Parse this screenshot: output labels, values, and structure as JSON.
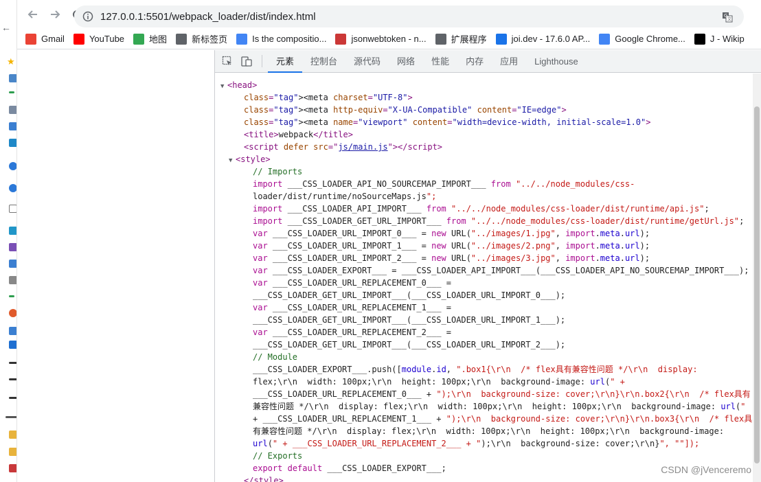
{
  "browser": {
    "url": "127.0.0.1:5501/webpack_loader/dist/index.html"
  },
  "bookmarks": [
    {
      "label": "Gmail",
      "icon": "gmail-icon",
      "color": "#ea4335"
    },
    {
      "label": "YouTube",
      "icon": "youtube-icon",
      "color": "#ff0000"
    },
    {
      "label": "地图",
      "icon": "maps-icon",
      "color": "#34a853"
    },
    {
      "label": "新标签页",
      "icon": "globe-icon",
      "color": "#5f6368"
    },
    {
      "label": "Is the compositio...",
      "icon": "google-icon",
      "color": "#4285f4"
    },
    {
      "label": "jsonwebtoken - n...",
      "icon": "npm-icon",
      "color": "#cb3837"
    },
    {
      "label": "扩展程序",
      "icon": "puzzle-icon",
      "color": "#5f6368"
    },
    {
      "label": "joi.dev - 17.6.0 AP...",
      "icon": "joi-icon",
      "color": "#1a73e8"
    },
    {
      "label": "Google Chrome...",
      "icon": "chrome-icon",
      "color": "#4285f4"
    },
    {
      "label": "J - Wikip",
      "icon": "wikipedia-icon",
      "color": "#000000"
    }
  ],
  "devtools": {
    "tabs": [
      "元素",
      "控制台",
      "源代码",
      "网络",
      "性能",
      "内存",
      "应用",
      "Lighthouse"
    ],
    "active_tab": "元素",
    "accent": "#1a73e8"
  },
  "code": {
    "head_open": "<head>",
    "meta_charset": "<meta charset=\"UTF-8\">",
    "meta_compat": "<meta http-equiv=\"X-UA-Compatible\" content=\"IE=edge\">",
    "meta_viewport": "<meta name=\"viewport\" content=\"width=device-width, initial-scale=1.0\">",
    "title": "webpack",
    "script_src": "js/main.js",
    "style_open": "<style>",
    "style_close": "</style>",
    "lines": [
      "// Imports",
      "import ___CSS_LOADER_API_NO_SOURCEMAP_IMPORT___ from \"../../node_modules/css-",
      "loader/dist/runtime/noSourceMaps.js\";",
      "import ___CSS_LOADER_API_IMPORT___ from \"../../node_modules/css-loader/dist/runtime/api.js\";",
      "import ___CSS_LOADER_GET_URL_IMPORT___ from \"../../node_modules/css-loader/dist/runtime/getUrl.js\";",
      "var ___CSS_LOADER_URL_IMPORT_0___ = new URL(\"../images/1.jpg\", import.meta.url);",
      "var ___CSS_LOADER_URL_IMPORT_1___ = new URL(\"../images/2.png\", import.meta.url);",
      "var ___CSS_LOADER_URL_IMPORT_2___ = new URL(\"../images/3.jpg\", import.meta.url);",
      "var ___CSS_LOADER_EXPORT___ = ___CSS_LOADER_API_IMPORT___(___CSS_LOADER_API_NO_SOURCEMAP_IMPORT___);",
      "var ___CSS_LOADER_URL_REPLACEMENT_0___ =",
      "___CSS_LOADER_GET_URL_IMPORT___(___CSS_LOADER_URL_IMPORT_0___);",
      "var ___CSS_LOADER_URL_REPLACEMENT_1___ =",
      "___CSS_LOADER_GET_URL_IMPORT___(___CSS_LOADER_URL_IMPORT_1___);",
      "var ___CSS_LOADER_URL_REPLACEMENT_2___ =",
      "___CSS_LOADER_GET_URL_IMPORT___(___CSS_LOADER_URL_IMPORT_2___);",
      "// Module",
      "___CSS_LOADER_EXPORT___.push([module.id, \".box1{\\r\\n  /* flex具有兼容性问题 */\\r\\n  display:",
      "flex;\\r\\n  width: 100px;\\r\\n  height: 100px;\\r\\n  background-image: url(\" +",
      "___CSS_LOADER_URL_REPLACEMENT_0___ + \");\\r\\n  background-size: cover;\\r\\n}\\r\\n.box2{\\r\\n  /* flex具有",
      "兼容性问题 */\\r\\n  display: flex;\\r\\n  width: 100px;\\r\\n  height: 100px;\\r\\n  background-image: url(\"",
      "+ ___CSS_LOADER_URL_REPLACEMENT_1___ + \");\\r\\n  background-size: cover;\\r\\n}\\r\\n.box3{\\r\\n  /* flex具",
      "有兼容性问题 */\\r\\n  display: flex;\\r\\n  width: 100px;\\r\\n  height: 100px;\\r\\n  background-image:",
      "url(\" + ___CSS_LOADER_URL_REPLACEMENT_2___ + \");\\r\\n  background-size: cover;\\r\\n}\", \"\"]);",
      "// Exports",
      "export default ___CSS_LOADER_EXPORT___;"
    ]
  },
  "watermark": "CSDN @jVenceremo"
}
